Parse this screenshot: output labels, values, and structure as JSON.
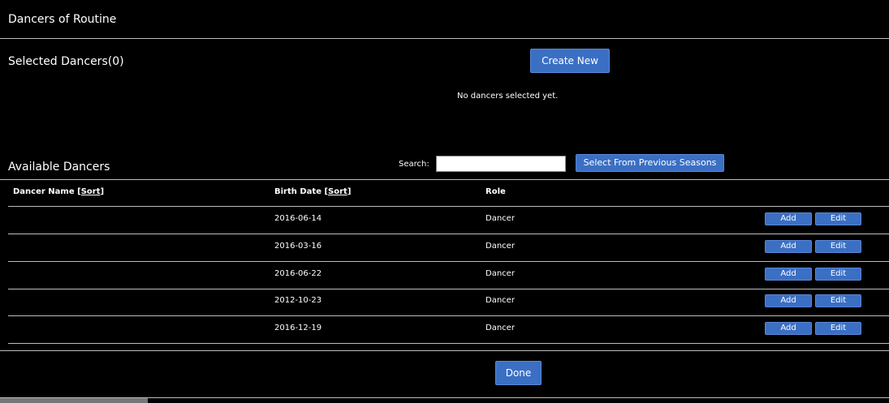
{
  "header": {
    "title": "Dancers of Routine"
  },
  "selected": {
    "title": "Selected Dancers(0)",
    "create_label": "Create New",
    "empty_message": "No dancers selected yet."
  },
  "available": {
    "title": "Available Dancers",
    "search_label": "Search:",
    "search_value": "",
    "prev_seasons_label": "Select From Previous Seasons",
    "columns": {
      "name": "Dancer Name",
      "birth": "Birth Date",
      "role": "Role",
      "sort_label": "Sort"
    },
    "rows": [
      {
        "name": "",
        "birth": "2016-06-14",
        "role": "Dancer",
        "add": "Add",
        "edit": "Edit"
      },
      {
        "name": "",
        "birth": "2016-03-16",
        "role": "Dancer",
        "add": "Add",
        "edit": "Edit"
      },
      {
        "name": "",
        "birth": "2016-06-22",
        "role": "Dancer",
        "add": "Add",
        "edit": "Edit"
      },
      {
        "name": "",
        "birth": "2012-10-23",
        "role": "Dancer",
        "add": "Add",
        "edit": "Edit"
      },
      {
        "name": "",
        "birth": "2016-12-19",
        "role": "Dancer",
        "add": "Add",
        "edit": "Edit"
      }
    ]
  },
  "footer": {
    "done_label": "Done"
  },
  "colors": {
    "button": "#3a6fc4",
    "background": "#000000",
    "divider": "#bdbdbd"
  }
}
